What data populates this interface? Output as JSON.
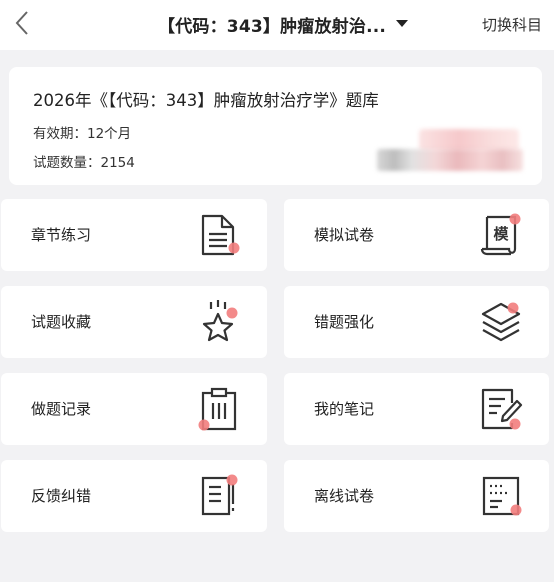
{
  "header": {
    "title": "【代码：343】肿瘤放射治...",
    "switch_label": "切换科目"
  },
  "bank": {
    "title": "2026年《【代码：343】肿瘤放射治疗学》题库",
    "validity": "有效期：12个月",
    "question_count": "试题数量：2154"
  },
  "menu": [
    {
      "label": "章节练习",
      "icon": "document-icon"
    },
    {
      "label": "模拟试卷",
      "icon": "scroll-exam-icon"
    },
    {
      "label": "试题收藏",
      "icon": "star-icon"
    },
    {
      "label": "错题强化",
      "icon": "layers-icon"
    },
    {
      "label": "做题记录",
      "icon": "clipboard-icon"
    },
    {
      "label": "我的笔记",
      "icon": "note-pen-icon"
    },
    {
      "label": "反馈纠错",
      "icon": "feedback-doc-icon"
    },
    {
      "label": "离线试卷",
      "icon": "offline-paper-icon"
    }
  ],
  "colors": {
    "icon_stroke": "#333333",
    "accent_dot": "#f27d7d",
    "background": "#f2f2f4",
    "card": "#ffffff"
  }
}
